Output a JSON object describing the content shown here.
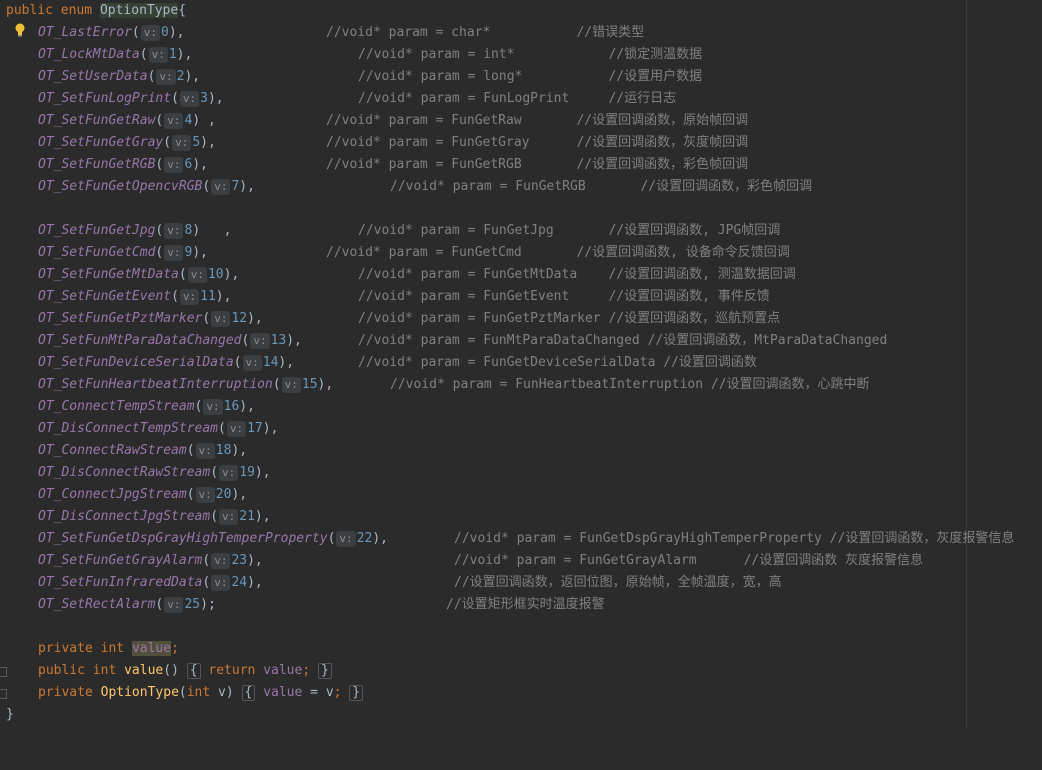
{
  "header": {
    "kw_public": "public",
    "kw_enum": "enum",
    "class_name": "OptionType",
    "brace": "{"
  },
  "hint_prefix": "v:",
  "enum_entries": [
    {
      "name": "OT_LastError",
      "value": "0",
      "suffix": "),",
      "comment": "//void* param = char*           //错误类型"
    },
    {
      "name": "OT_LockMtData",
      "value": "1",
      "suffix": "),",
      "comment": "//void* param = int*            //锁定测温数据"
    },
    {
      "name": "OT_SetUserData",
      "value": "2",
      "suffix": "),",
      "comment": "//void* param = long*           //设置用户数据"
    },
    {
      "name": "OT_SetFunLogPrint",
      "value": "3",
      "suffix": "),",
      "comment": "//void* param = FunLogPrint     //运行日志"
    },
    {
      "name": "OT_SetFunGetRaw",
      "value": "4",
      "suffix": ") ,",
      "comment": "//void* param = FunGetRaw       //设置回调函数，原始帧回调"
    },
    {
      "name": "OT_SetFunGetGray",
      "value": "5",
      "suffix": "),",
      "comment": "//void* param = FunGetGray      //设置回调函数，灰度帧回调"
    },
    {
      "name": "OT_SetFunGetRGB",
      "value": "6",
      "suffix": "),",
      "comment": "//void* param = FunGetRGB       //设置回调函数，彩色帧回调"
    },
    {
      "name": "OT_SetFunGetOpencvRGB",
      "value": "7",
      "suffix": "),",
      "comment": "//void* param = FunGetRGB       //设置回调函数，彩色帧回调"
    },
    {
      "name": "OT_SetFunGetJpg",
      "value": "8",
      "suffix": ")   ,",
      "comment": "//void* param = FunGetJpg       //设置回调函数, JPG帧回调"
    },
    {
      "name": "OT_SetFunGetCmd",
      "value": "9",
      "suffix": "),",
      "comment": "//void* param = FunGetCmd       //设置回调函数, 设备命令反馈回调"
    },
    {
      "name": "OT_SetFunGetMtData",
      "value": "10",
      "suffix": "),",
      "comment": "//void* param = FunGetMtData    //设置回调函数, 测温数据回调"
    },
    {
      "name": "OT_SetFunGetEvent",
      "value": "11",
      "suffix": "),",
      "comment": "//void* param = FunGetEvent     //设置回调函数, 事件反馈"
    },
    {
      "name": "OT_SetFunGetPztMarker",
      "value": "12",
      "suffix": "),",
      "comment": "//void* param = FunGetPztMarker //设置回调函数，巡航预置点"
    },
    {
      "name": "OT_SetFunMtParaDataChanged",
      "value": "13",
      "suffix": "),",
      "comment": "//void* param = FunMtParaDataChanged //设置回调函数，MtParaDataChanged"
    },
    {
      "name": "OT_SetFunDeviceSerialData",
      "value": "14",
      "suffix": "),",
      "comment": "//void* param = FunGetDeviceSerialData //设置回调函数"
    },
    {
      "name": "OT_SetFunHeartbeatInterruption",
      "value": "15",
      "suffix": "),",
      "comment": "//void* param = FunHeartbeatInterruption //设置回调函数，心跳中断"
    },
    {
      "name": "OT_ConnectTempStream",
      "value": "16",
      "suffix": "),",
      "comment": ""
    },
    {
      "name": "OT_DisConnectTempStream",
      "value": "17",
      "suffix": "),",
      "comment": ""
    },
    {
      "name": "OT_ConnectRawStream",
      "value": "18",
      "suffix": "),",
      "comment": ""
    },
    {
      "name": "OT_DisConnectRawStream",
      "value": "19",
      "suffix": "),",
      "comment": ""
    },
    {
      "name": "OT_ConnectJpgStream",
      "value": "20",
      "suffix": "),",
      "comment": ""
    },
    {
      "name": "OT_DisConnectJpgStream",
      "value": "21",
      "suffix": "),",
      "comment": ""
    },
    {
      "name": "OT_SetFunGetDspGrayHighTemperProperty",
      "value": "22",
      "suffix": "),",
      "comment": "//void* param = FunGetDspGrayHighTemperProperty //设置回调函数，灰度报警信息"
    },
    {
      "name": "OT_SetFunGetGrayAlarm",
      "value": "23",
      "suffix": "),",
      "comment": "//void* param = FunGetGrayAlarm      //设置回调函数 灰度报警信息"
    },
    {
      "name": "OT_SetFunInfraredData",
      "value": "24",
      "suffix": "),",
      "comment": "//设置回调函数，返回位图，原始帧，全帧温度，宽，高"
    },
    {
      "name": "OT_SetRectAlarm",
      "value": "25",
      "suffix": ");",
      "comment": "//设置矩形框实时温度报警"
    }
  ],
  "field_decl": {
    "kw_private": "private",
    "kw_int": "int",
    "field": "value",
    "semicolon": ";"
  },
  "getter": {
    "kw_public": "public",
    "kw_int": "int",
    "method": "value",
    "parens": "()",
    "open_brace": "{",
    "kw_return": "return",
    "field": "value",
    "semicolon": ";",
    "close_brace": "}"
  },
  "ctor": {
    "kw_private": "private",
    "class_name": "OptionType",
    "open_paren": "(",
    "kw_int": "int",
    "param": "v",
    "close_paren": ")",
    "open_brace": "{",
    "field": "value",
    "assign": "=",
    "param_ref": "v",
    "semicolon": ";",
    "close_brace": "}"
  },
  "closing_brace": "}"
}
